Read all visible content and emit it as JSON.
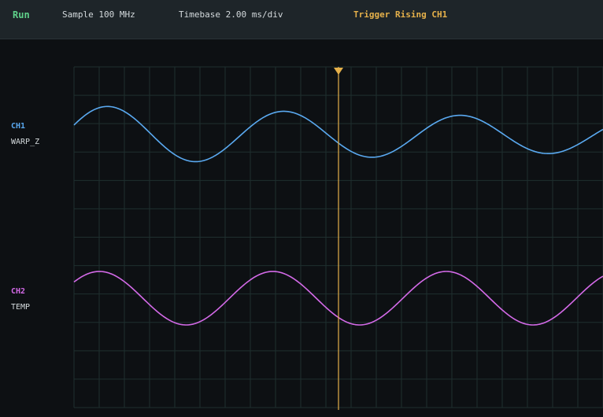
{
  "status": {
    "run_label": "Run",
    "sample": "Sample 100 MHz",
    "timebase": "Timebase 2.00 ms/div",
    "trigger": "Trigger Rising CH1"
  },
  "colors": {
    "run": "#5fd18a",
    "trigger": "#e5b04a",
    "ch1": "#5aa9f0",
    "ch2": "#d46ae8",
    "grid": "#1f2f2f",
    "grid_minor": "#17201f"
  },
  "channels": [
    {
      "id": "CH1",
      "name": "WARP_Z"
    },
    {
      "id": "CH2",
      "name": "TEMP"
    }
  ],
  "grid": {
    "divisions_x": 21,
    "divisions_y": 12
  },
  "trigger_marker": {
    "position_fraction": 0.5
  },
  "chart_data": {
    "type": "line",
    "x": [
      0,
      0.05,
      0.1,
      0.15,
      0.2,
      0.25,
      0.3,
      0.35,
      0.4,
      0.45,
      0.5,
      0.55,
      0.6,
      0.65,
      0.7,
      0.75,
      0.8,
      0.85,
      0.9,
      0.95,
      1
    ],
    "series": [
      {
        "name": "CH1",
        "shape": "damped-sine",
        "cycles": 3,
        "amplitude": 1.0,
        "decay": 0.55,
        "phase": 0.35,
        "offset": 0
      },
      {
        "name": "CH2",
        "shape": "sine",
        "cycles": 3.05,
        "amplitude": 1.0,
        "phase": 0.65,
        "offset": 0
      }
    ]
  }
}
